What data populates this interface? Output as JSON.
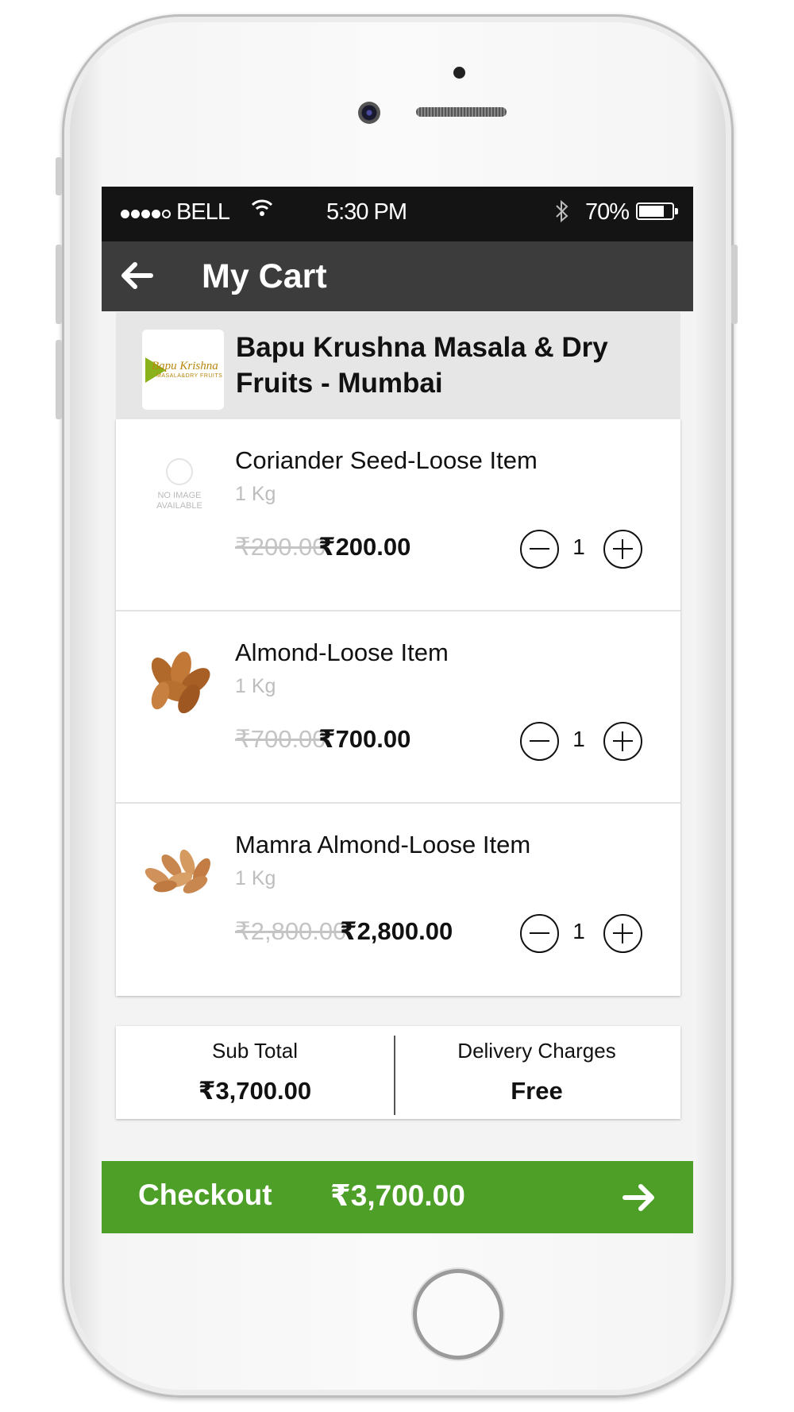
{
  "status_bar": {
    "carrier": "BELL",
    "time": "5:30 PM",
    "battery_percent": "70%"
  },
  "app_bar": {
    "title": "My Cart"
  },
  "store": {
    "name": "Bapu Krushna Masala & Dry Fruits - Mumbai",
    "logo_title": "Bapu Krishna",
    "logo_subtitle": "MASALA&DRY FRUITS"
  },
  "items": [
    {
      "name": "Coriander Seed-Loose Item",
      "unit": "1 Kg",
      "original_price": "₹200.00",
      "price": "₹200.00",
      "quantity": "1",
      "image": "no-image",
      "no_image_text": "NO IMAGE AVAILABLE"
    },
    {
      "name": "Almond-Loose Item",
      "unit": "1 Kg",
      "original_price": "₹700.00",
      "price": "₹700.00",
      "quantity": "1",
      "image": "almond-icon"
    },
    {
      "name": "Mamra Almond-Loose Item",
      "unit": "1 Kg",
      "original_price": "₹2,800.00",
      "price": "₹2,800.00",
      "quantity": "1",
      "image": "mamra-almond-icon"
    }
  ],
  "summary": {
    "subtotal_label": "Sub Total",
    "subtotal_value": "₹3,700.00",
    "delivery_label": "Delivery Charges",
    "delivery_value": "Free"
  },
  "checkout": {
    "label": "Checkout",
    "amount": "₹3,700.00"
  },
  "colors": {
    "checkout_green": "#4e9f28",
    "app_bar": "#3c3c3c",
    "status_bar": "#141414"
  }
}
